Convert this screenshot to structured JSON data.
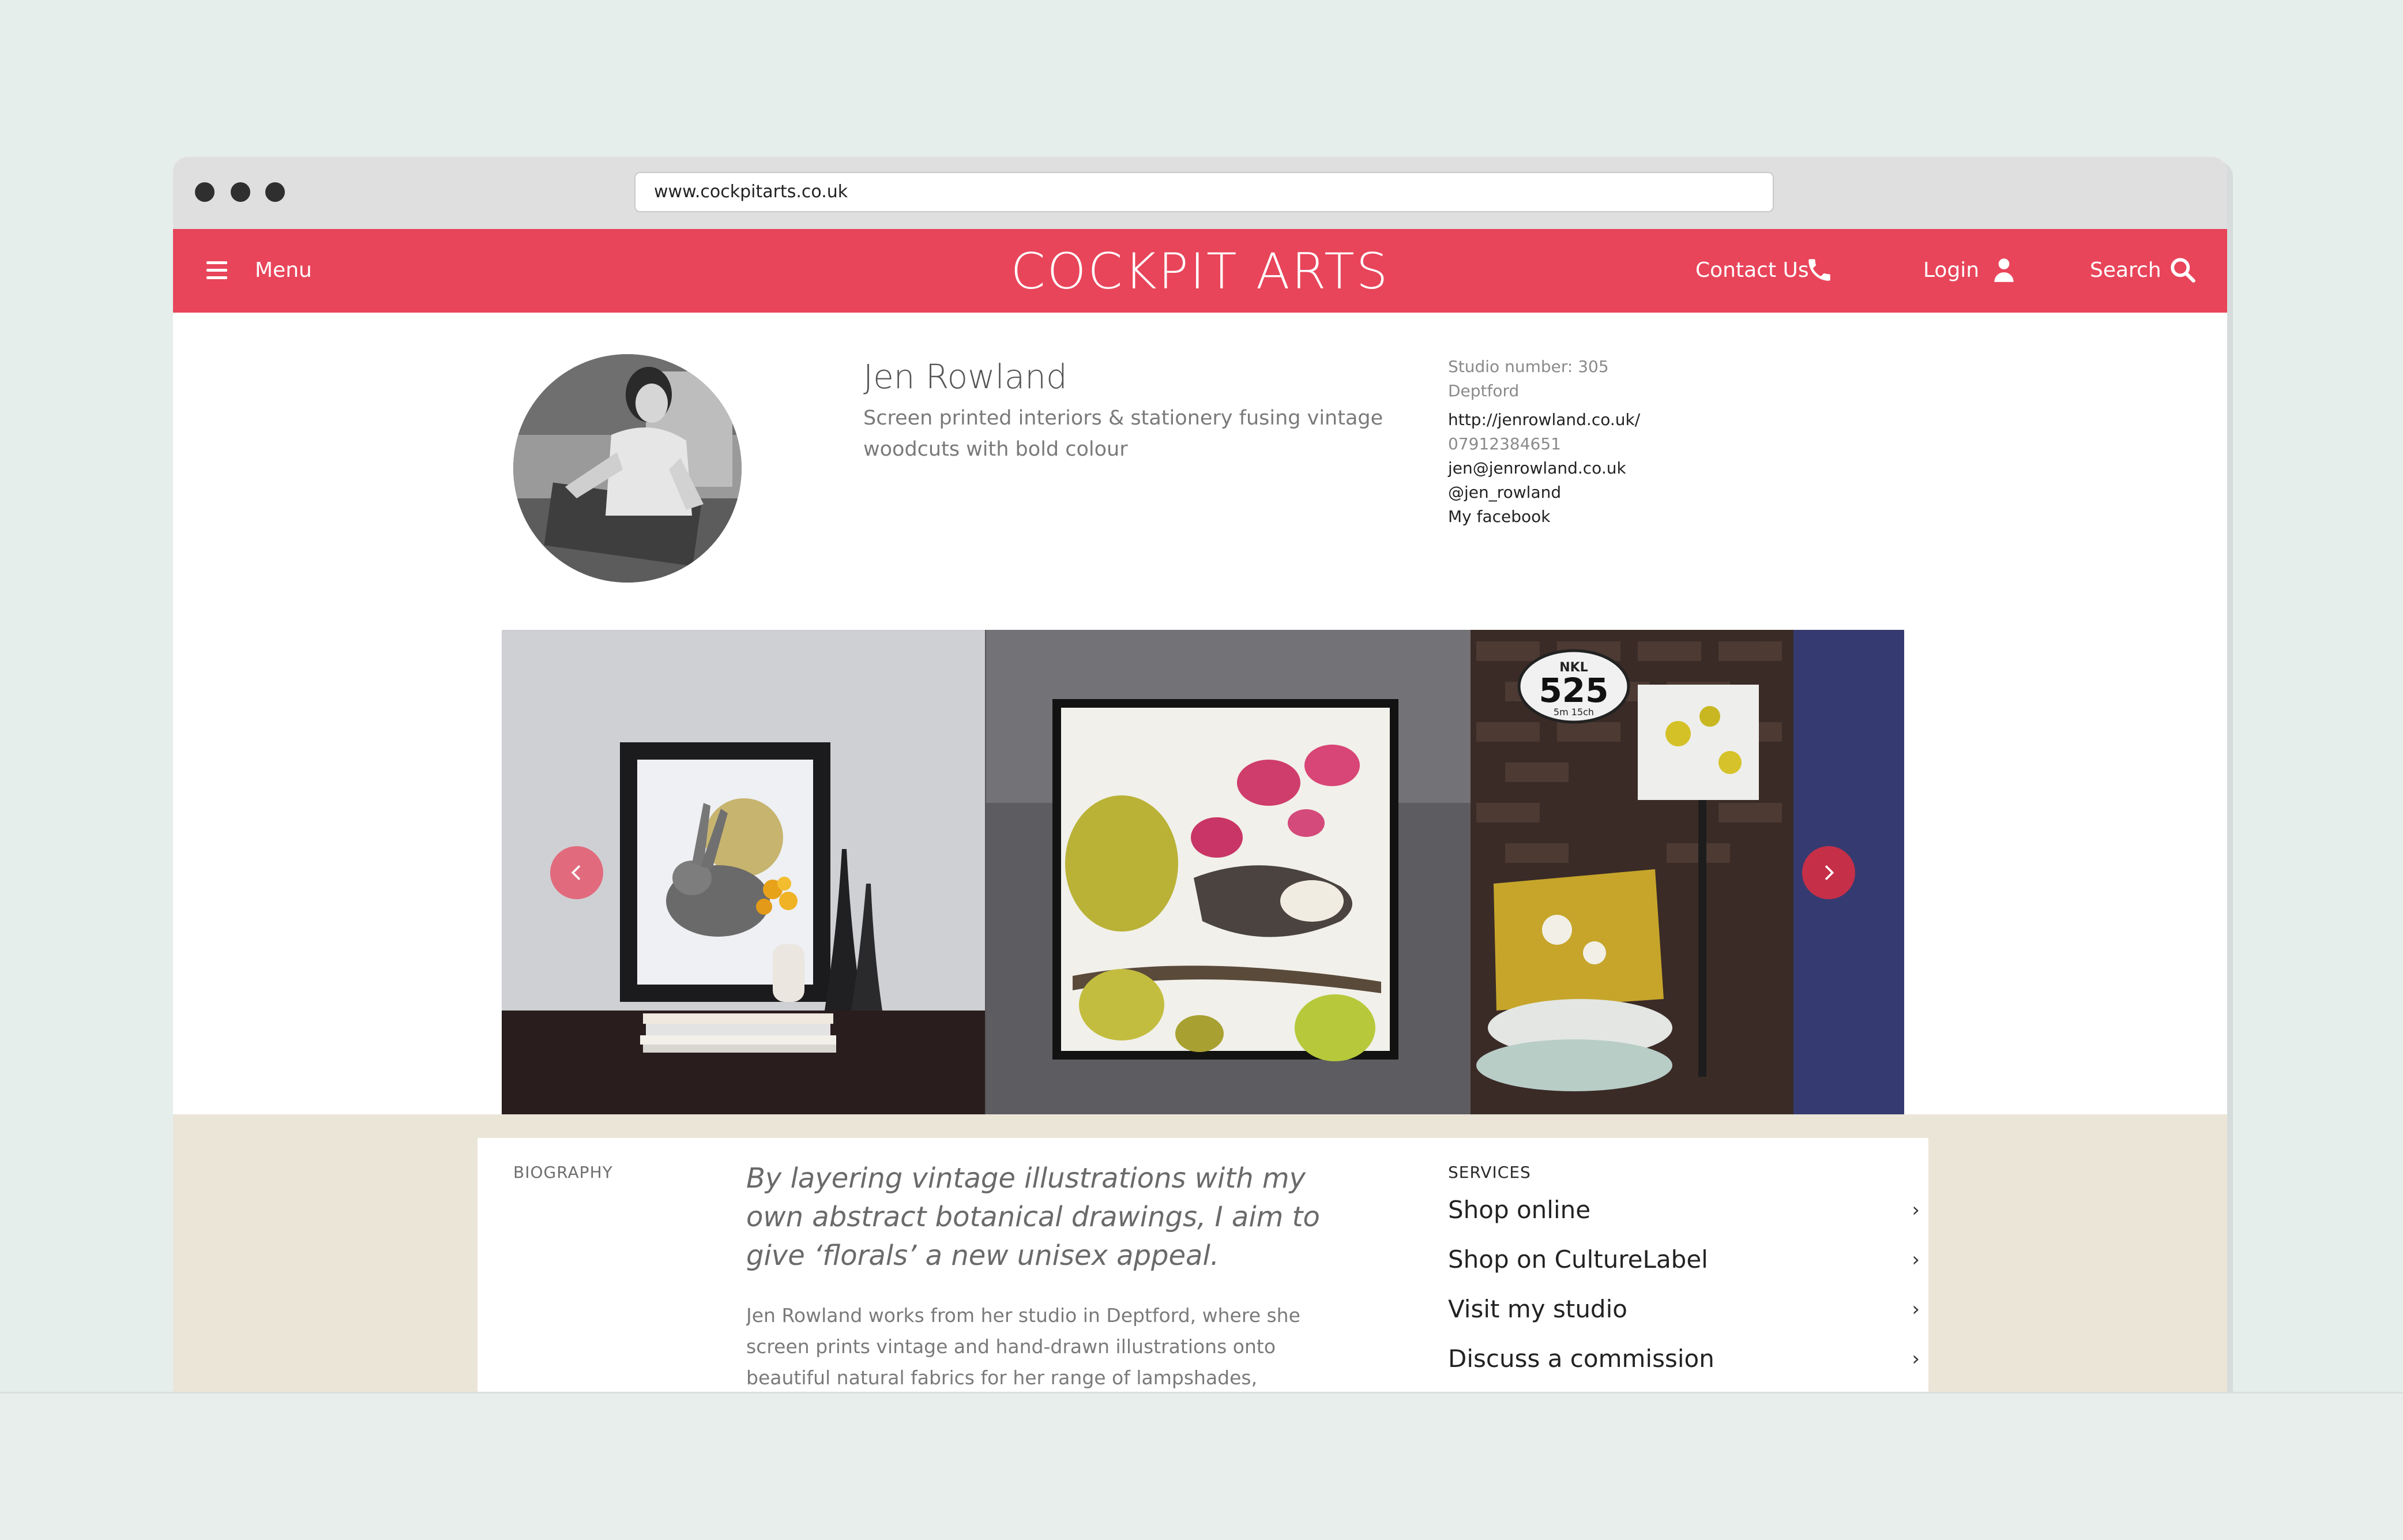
{
  "browser": {
    "url": "www.cockpitarts.co.uk"
  },
  "header": {
    "menu_label": "Menu",
    "brand": "COCKPIT ARTS",
    "contact_label": "Contact Us",
    "login_label": "Login",
    "search_label": "Search",
    "accent_color": "#e8455a"
  },
  "profile": {
    "name": "Jen Rowland",
    "tagline": "Screen printed interiors & stationery fusing vintage woodcuts with bold colour",
    "studio_number": "Studio number: 305",
    "location": "Deptford",
    "website": "http://jenrowland.co.uk/",
    "phone": "07912384651",
    "email": "jen@jenrowland.co.uk",
    "twitter": "@jen_rowland",
    "facebook": "My facebook"
  },
  "gallery": {
    "sign_top": "NKL",
    "sign_number": "525",
    "sign_sub": "5m 15ch"
  },
  "biography": {
    "label": "BIOGRAPHY",
    "quote": "By layering vintage illustrations with my own abstract botanical drawings, I aim to give ‘florals’ a new unisex appeal.",
    "text": "Jen Rowland works from her studio in Deptford, where she screen prints vintage and hand-drawn illustrations onto beautiful natural fabrics for her range of lampshades, cushions"
  },
  "services": {
    "label": "SERVICES",
    "items": [
      {
        "label": "Shop online"
      },
      {
        "label": "Shop on CultureLabel"
      },
      {
        "label": "Visit my studio"
      },
      {
        "label": "Discuss a commission"
      }
    ]
  }
}
